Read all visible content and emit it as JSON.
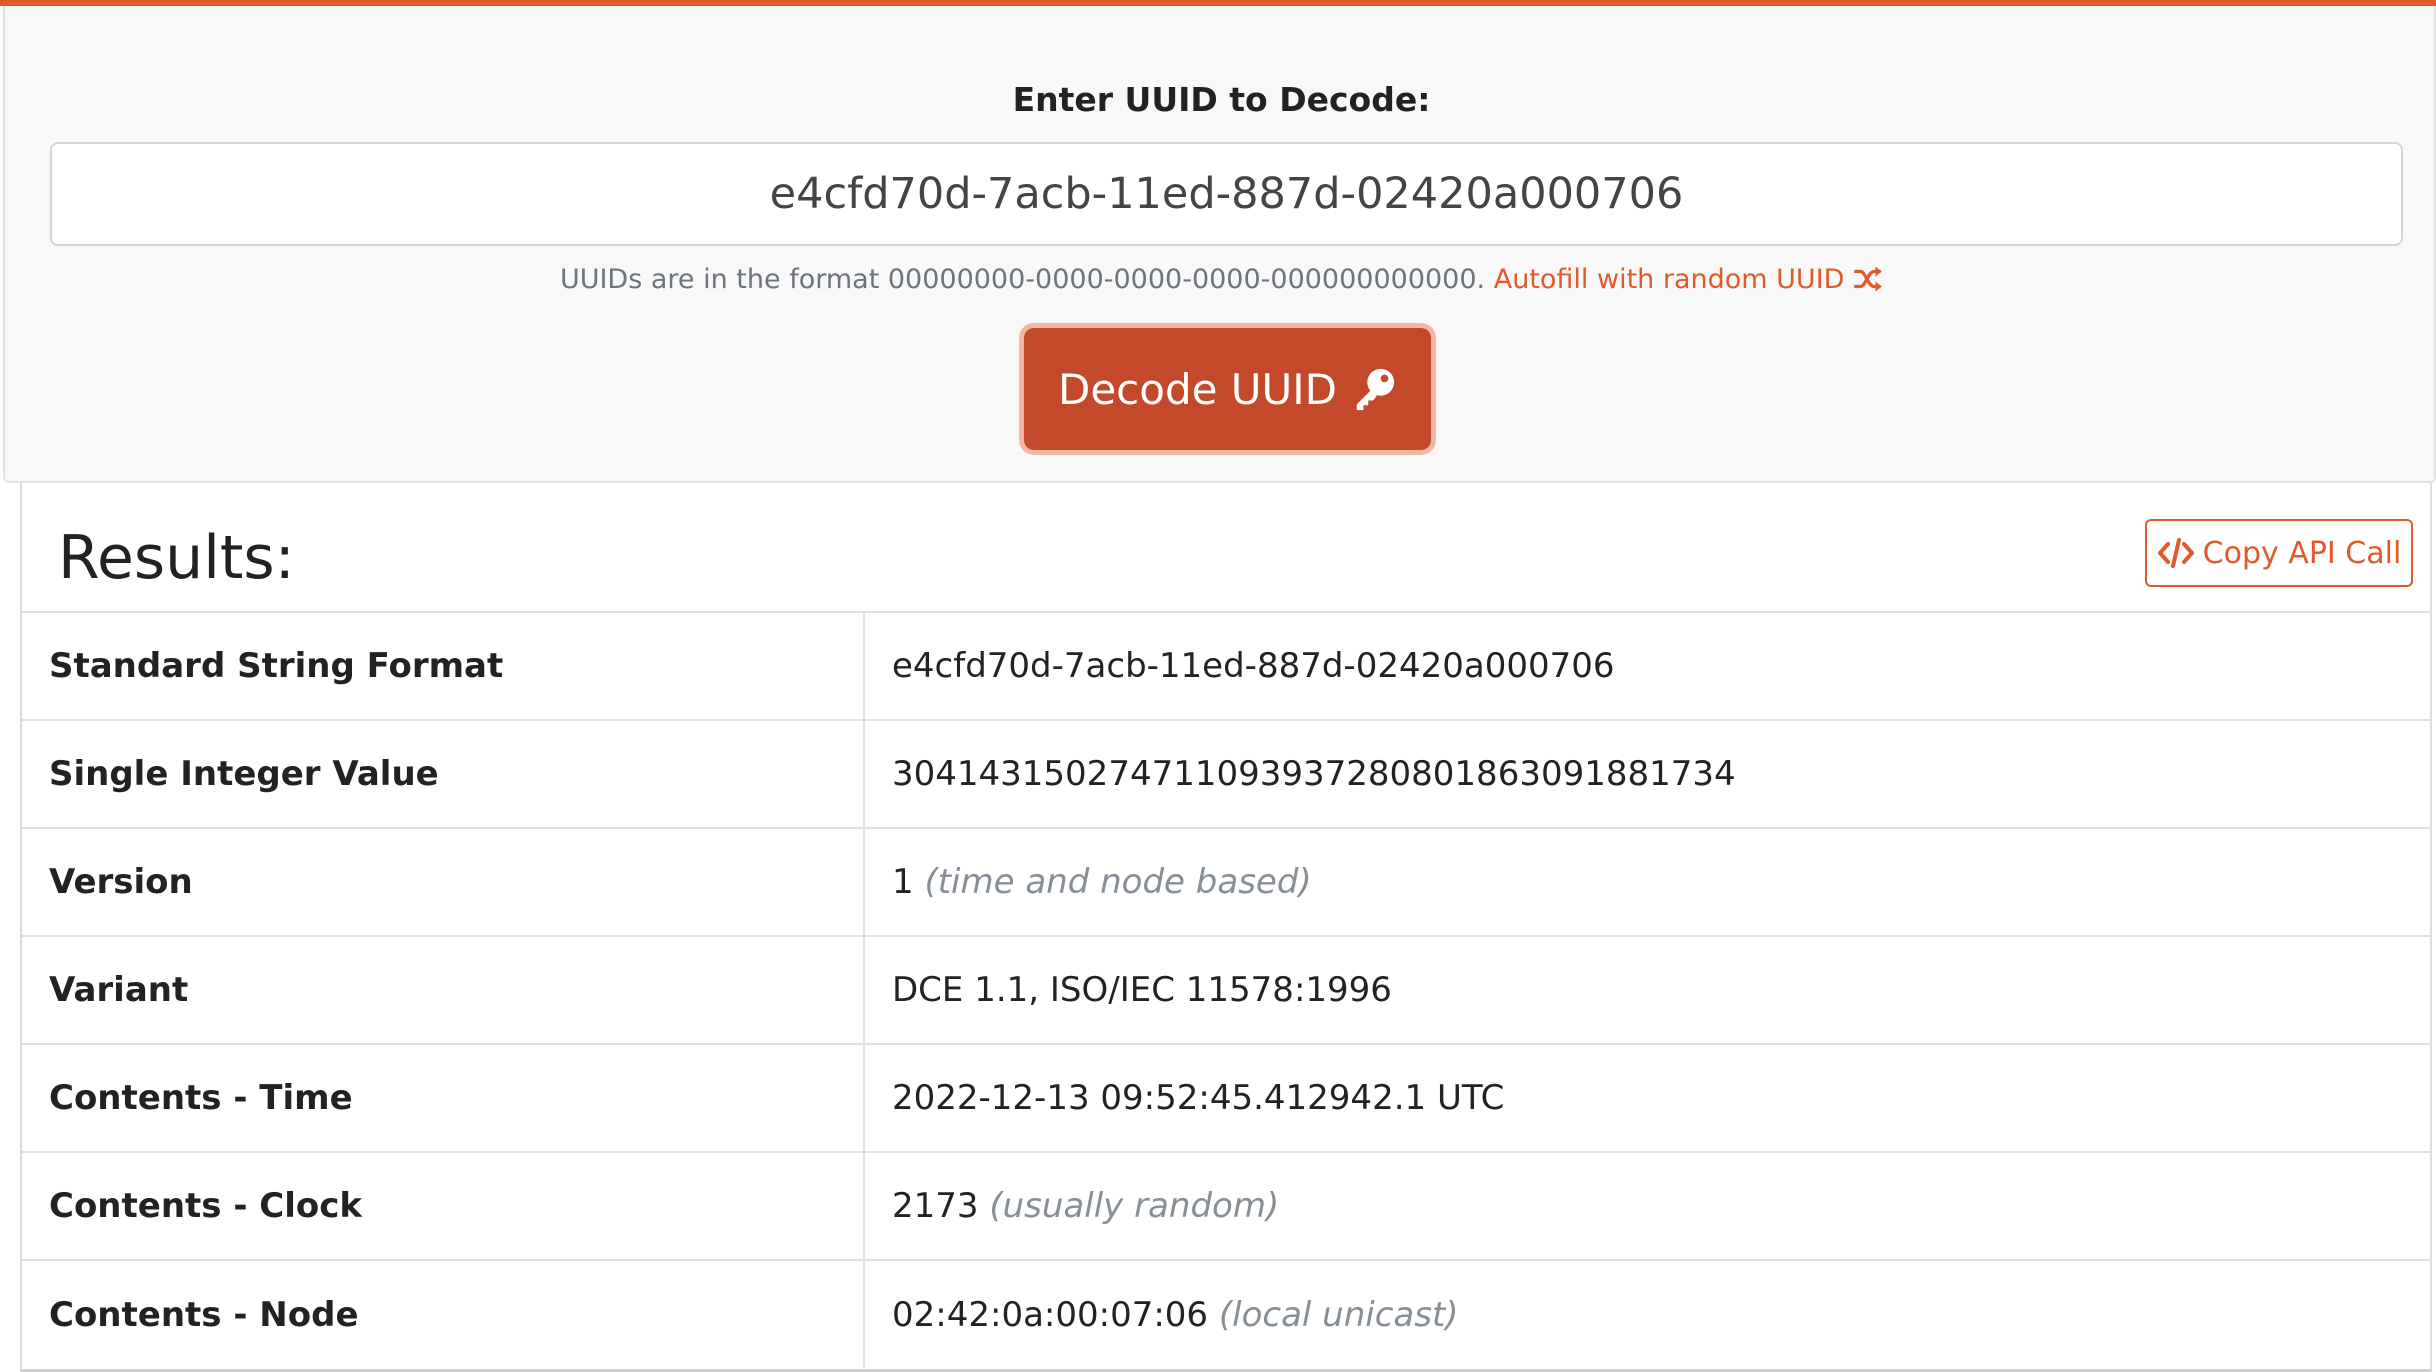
{
  "colors": {
    "accent": "#e05a2b",
    "button_bg": "#c4492a",
    "muted": "#6c757d",
    "note": "#868e96"
  },
  "decode": {
    "label": "Enter UUID to Decode:",
    "input_value": "e4cfd70d-7acb-11ed-887d-02420a000706",
    "help_text": "UUIDs are in the format 00000000-0000-0000-0000-000000000000.",
    "autofill_label": "Autofill with random UUID",
    "autofill_icon": "shuffle-icon",
    "button_label": "Decode UUID",
    "button_icon": "key-icon"
  },
  "results": {
    "title": "Results:",
    "copy_button_label": "Copy API Call",
    "copy_button_icon": "code-icon",
    "rows": [
      {
        "label": "Standard String Format",
        "value": "e4cfd70d-7acb-11ed-887d-02420a000706",
        "note": ""
      },
      {
        "label": "Single Integer Value",
        "value": "304143150274711093937280801863091881734",
        "note": ""
      },
      {
        "label": "Version",
        "value": "1",
        "note": "(time and node based)"
      },
      {
        "label": "Variant",
        "value": "DCE 1.1, ISO/IEC 11578:1996",
        "note": ""
      },
      {
        "label": "Contents - Time",
        "value": "2022-12-13 09:52:45.412942.1 UTC",
        "note": ""
      },
      {
        "label": "Contents - Clock",
        "value": "2173",
        "note": "(usually random)"
      },
      {
        "label": "Contents - Node",
        "value": "02:42:0a:00:07:06",
        "note": "(local unicast)"
      }
    ]
  }
}
